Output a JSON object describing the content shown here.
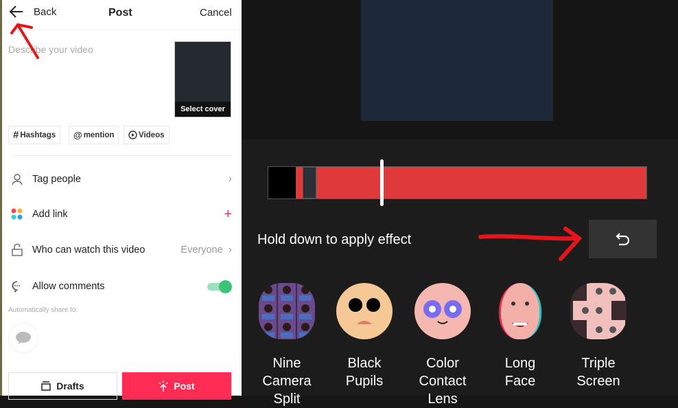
{
  "header": {
    "back_label": "Back",
    "title": "Post",
    "cancel_label": "Cancel"
  },
  "description": {
    "placeholder": "Describe your video"
  },
  "cover": {
    "label": "Select cover"
  },
  "chips": [
    {
      "icon": "hashtag-icon",
      "label": "Hashtags"
    },
    {
      "icon": "at-icon",
      "label": "mention"
    },
    {
      "icon": "play-circle-icon",
      "label": "Videos"
    }
  ],
  "options": {
    "tag_people": "Tag people",
    "add_link": "Add link",
    "who_can_watch": "Who can watch this video",
    "who_can_watch_value": "Everyone",
    "allow_comments": "Allow comments",
    "allow_comments_on": true
  },
  "share": {
    "label": "Automatically share to:"
  },
  "buttons": {
    "drafts": "Drafts",
    "post": "Post"
  },
  "editor": {
    "hint": "Hold down to apply effect",
    "timeline_playhead_percent": 30,
    "effects": [
      {
        "line1": "Nine",
        "line2": "Camera",
        "line3": "Split"
      },
      {
        "line1": "Black",
        "line2": "Pupils",
        "line3": ""
      },
      {
        "line1": "Color",
        "line2": "Contact",
        "line3": "Lens"
      },
      {
        "line1": "Long",
        "line2": "Face",
        "line3": ""
      },
      {
        "line1": "Triple",
        "line2": "Screen",
        "line3": ""
      }
    ]
  },
  "colors": {
    "accent": "#fe2c55",
    "toggle": "#3cc37a",
    "timeline": "#e03a3a",
    "annotation": "#e8141a"
  }
}
